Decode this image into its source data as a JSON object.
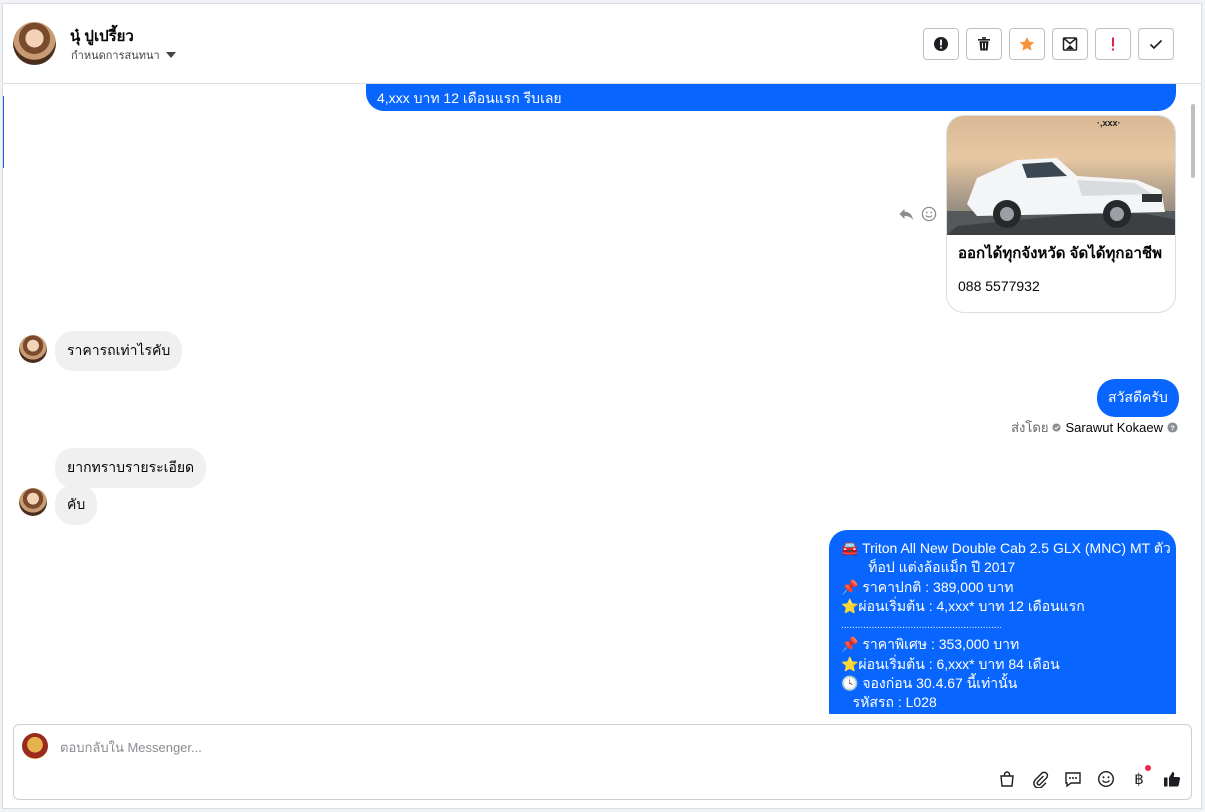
{
  "header": {
    "contact_name": "นุ๋ ปูเปรี้ยว",
    "conversation_status": "กำหนดการสนทนา",
    "actions": [
      {
        "name": "report-button",
        "icon": "alert-circle-icon"
      },
      {
        "name": "delete-button",
        "icon": "trash-icon"
      },
      {
        "name": "star-button",
        "icon": "star-icon",
        "color": "#f7923b"
      },
      {
        "name": "archive-button",
        "icon": "mail-x-icon"
      },
      {
        "name": "flag-important-button",
        "icon": "exclamation-icon",
        "color": "#e41e3f"
      },
      {
        "name": "mark-done-button",
        "icon": "check-icon"
      }
    ]
  },
  "messages": {
    "top_out": "4,xxx บาท 12 เดือนแรก รีบเลย",
    "card": {
      "title": "ออกได้ทุกจังหวัด จัดได้ทุกอาชีพ",
      "phone": "088 5577932"
    },
    "in_price": "ราคารถเท่าไรคับ",
    "out_greeting": "สวัสดีครับ",
    "sent_by_label": "ส่งโดย",
    "sent_by_name": "Sarawut Kokaew",
    "in_detail": "ยากทราบรายระเอียด",
    "in_kub": "คับ",
    "long_lines": [
      "🚘 Triton All New Double Cab 2.5 GLX (MNC) MT ตัว",
      "       ท็อป แต่งล้อแม็ก ปี 2017",
      "📌 ราคาปกติ : 389,000 บาท",
      "⭐ผ่อนเริ่มต้น : 4,xxx* บาท 12 เดือนแรก",
      "..............................................................",
      "📌 ราคาพิเศษ : 353,000 บาท",
      "⭐ผ่อนเริ่มต้น : 6,xxx* บาท 84 เดือน",
      "🕓 จองก่อน 30.4.67 นี้เท่านั้น",
      "   รหัสรถ : L028"
    ]
  },
  "composer": {
    "placeholder": "ตอบกลับใน Messenger...",
    "tools": [
      "shopping-bag-icon",
      "paperclip-icon",
      "saved-reply-icon",
      "emoji-icon",
      "baht-payment-icon",
      "thumbs-up-icon"
    ]
  },
  "colors": {
    "accent": "#0866ff",
    "incoming": "#f0f0f0"
  }
}
